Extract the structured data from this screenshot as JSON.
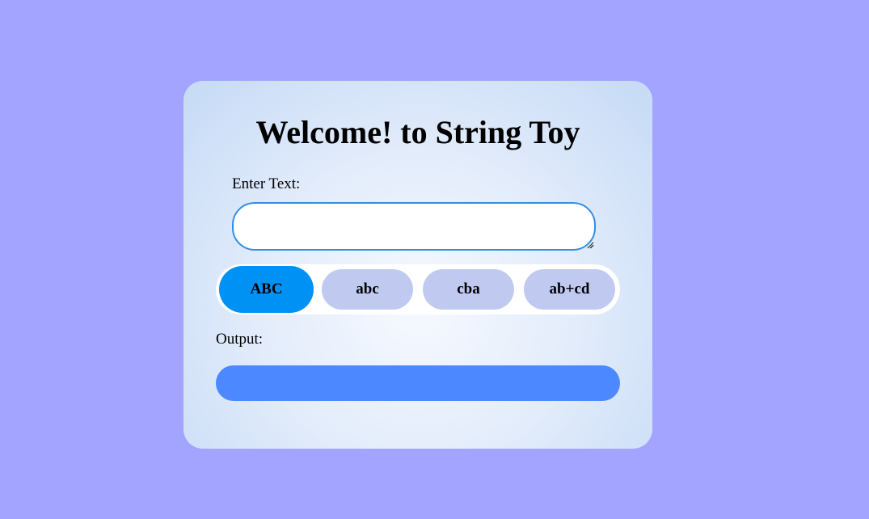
{
  "app": {
    "title": "Welcome! to String Toy"
  },
  "input": {
    "label": "Enter Text:",
    "value": "",
    "placeholder": ""
  },
  "buttons": [
    {
      "label": "ABC",
      "active": true
    },
    {
      "label": "abc",
      "active": false
    },
    {
      "label": "cba",
      "active": false
    },
    {
      "label": "ab+cd",
      "active": false
    }
  ],
  "output": {
    "label": "Output:",
    "value": ""
  },
  "colors": {
    "page_background": "#a3a4ff",
    "active_button": "#0091f5",
    "inactive_button": "#c0caf1",
    "output_box": "#4c88ff",
    "input_border": "#2f8fe6"
  },
  "icons": {
    "textarea_resize": "resize-grip-icon"
  }
}
